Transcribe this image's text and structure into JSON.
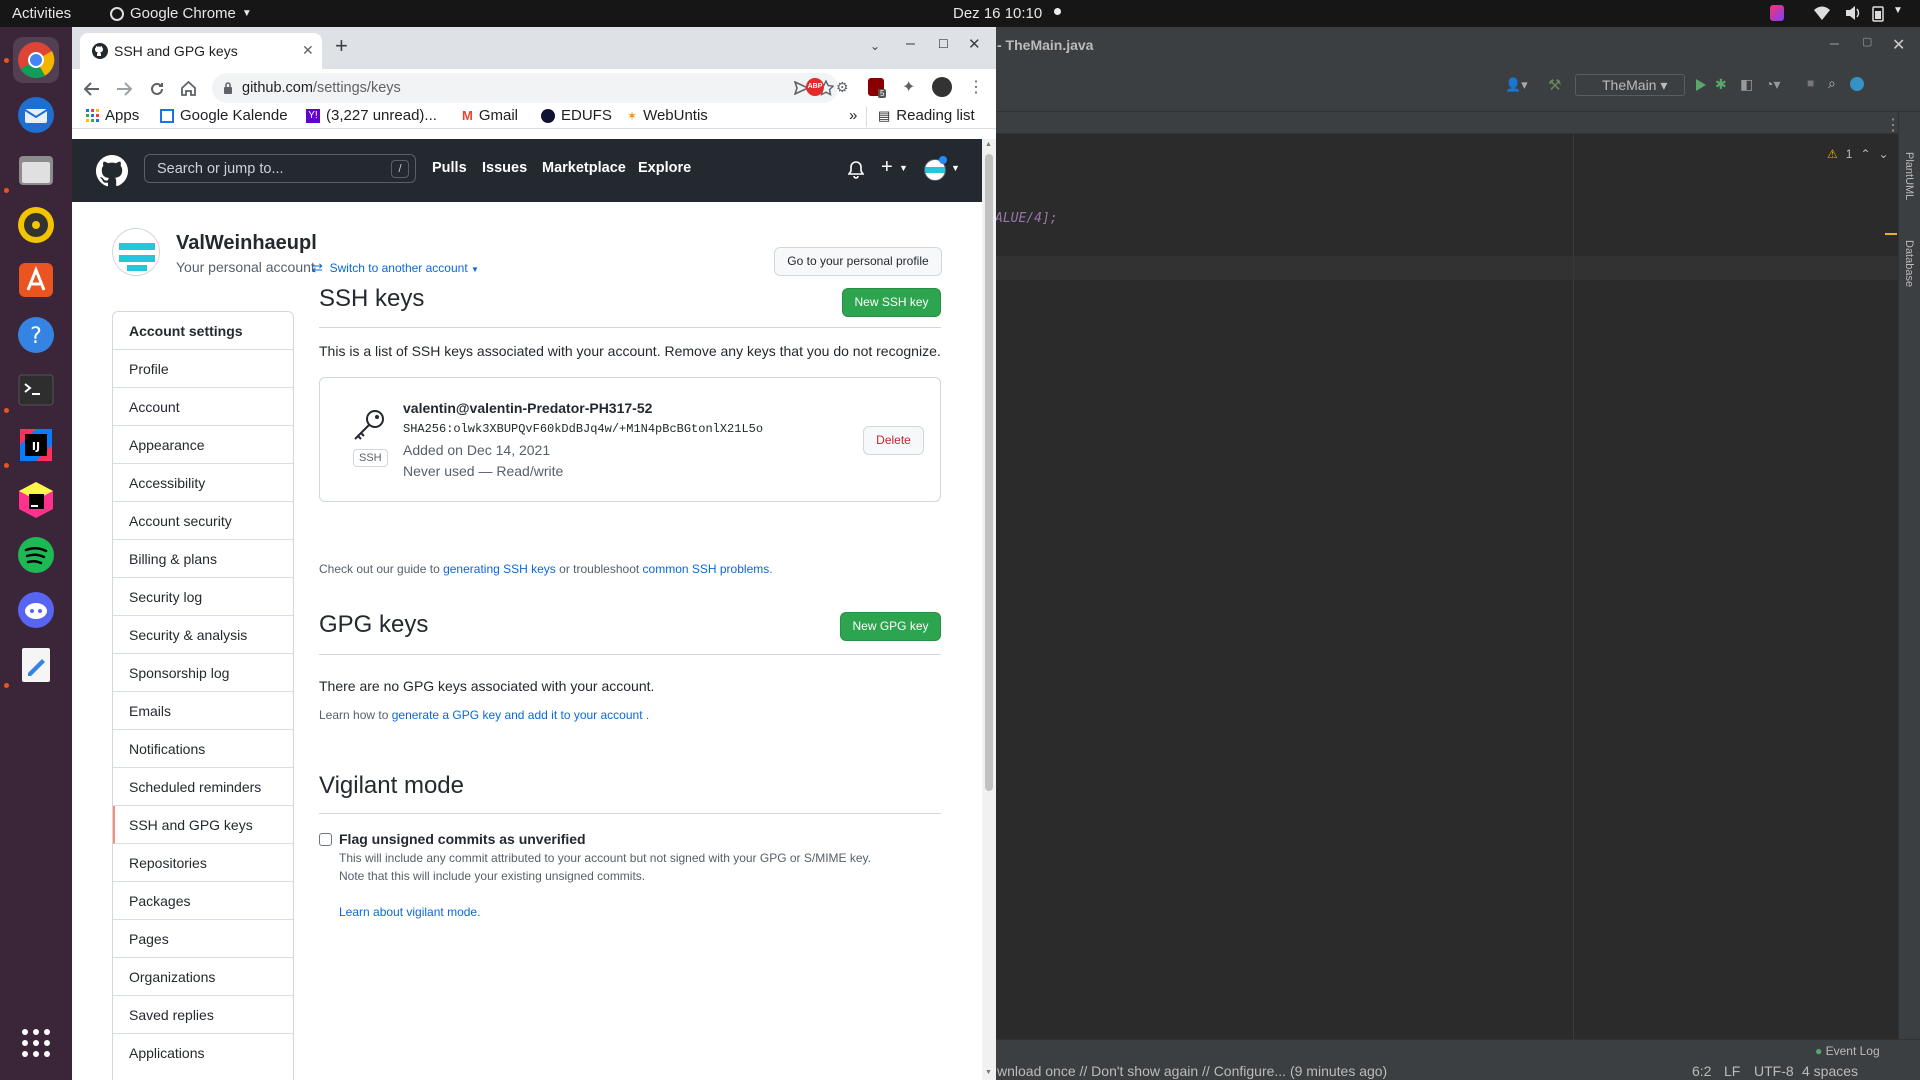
{
  "system": {
    "activities": "Activities",
    "app_name": "Google Chrome",
    "clock": "Dez 16  10:10"
  },
  "ide": {
    "title": "- TheMain.java",
    "run_config": "TheMain",
    "code_fragment": "ALUE/4];",
    "warning_count": "1",
    "tool_plantuml": "PlantUML",
    "tool_database": "Database",
    "event_log": "Event Log",
    "notification": "wnload once // Don't show again // Configure... (9 minutes ago)",
    "status": {
      "position": "6:2",
      "line_sep": "LF",
      "encoding": "UTF-8",
      "indent": "4 spaces"
    }
  },
  "browser": {
    "tab_title": "SSH and GPG keys",
    "url_host": "github.com",
    "url_path": "/settings/keys",
    "bookmarks": [
      {
        "label": "Apps"
      },
      {
        "label": "Google Kalende"
      },
      {
        "label": "(3,227 unread)..."
      },
      {
        "label": "Gmail"
      },
      {
        "label": "EDUFS"
      },
      {
        "label": "WebUntis"
      }
    ],
    "bookmark_more": "»",
    "reading_list": "Reading list",
    "ext_badge": "5"
  },
  "github": {
    "search_placeholder": "Search or jump to...",
    "search_key": "/",
    "nav": [
      "Pulls",
      "Issues",
      "Marketplace",
      "Explore"
    ],
    "username": "ValWeinhaeupl",
    "account_type": "Your personal account",
    "switch_account": "Switch to another account",
    "profile_button": "Go to your personal profile",
    "sidebar": {
      "header": "Account settings",
      "items": [
        "Profile",
        "Account",
        "Appearance",
        "Accessibility",
        "Account security",
        "Billing & plans",
        "Security log",
        "Security & analysis",
        "Sponsorship log",
        "Emails",
        "Notifications",
        "Scheduled reminders",
        "SSH and GPG keys",
        "Repositories",
        "Packages",
        "Pages",
        "Organizations",
        "Saved replies",
        "Applications"
      ]
    },
    "ssh": {
      "title": "SSH keys",
      "new_button": "New SSH key",
      "description": "This is a list of SSH keys associated with your account. Remove any keys that you do not recognize.",
      "key": {
        "name": "valentin@valentin-Predator-PH317-52",
        "fingerprint": "SHA256:olwk3XBUPQvF60kDdBJq4w/+M1N4pBcBGtonlX21L5o",
        "added": "Added on Dec 14, 2021",
        "usage": "Never used — Read/write",
        "badge": "SSH",
        "delete": "Delete"
      },
      "help_prefix": "Check out our guide to ",
      "help_link1": "generating SSH keys",
      "help_mid": " or troubleshoot ",
      "help_link2": "common SSH problems",
      "help_suffix": "."
    },
    "gpg": {
      "title": "GPG keys",
      "new_button": "New GPG key",
      "empty": "There are no GPG keys associated with your account.",
      "help_prefix": "Learn how to ",
      "help_link": "generate a GPG key and add it to your account",
      "help_suffix": " ."
    },
    "vigilant": {
      "title": "Vigilant mode",
      "checkbox_label": "Flag unsigned commits as unverified",
      "desc1": "This will include any commit attributed to your account but not signed with your GPG or S/MIME key.",
      "desc2": "Note that this will include your existing unsigned commits.",
      "link": "Learn about vigilant mode."
    }
  },
  "colors": {
    "github_header": "#24292f",
    "primary_green": "#2da44e",
    "link_blue": "#0969da",
    "dock_bg": "#3b2539",
    "ide_bg": "#2b2b2b"
  }
}
